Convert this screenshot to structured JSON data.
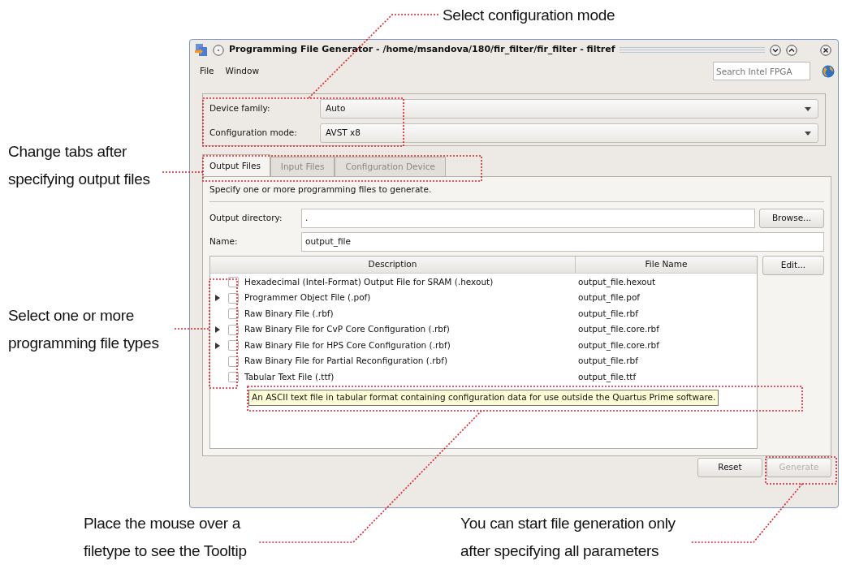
{
  "callouts": [
    {
      "text": "Select configuration mode"
    },
    {
      "text": "Change tabs after specifying output files"
    },
    {
      "text": "Select one or more programming file types"
    },
    {
      "text": "Place the mouse over a filetype to see the Tooltip"
    },
    {
      "text": "You can start file generation only after specifying all parameters"
    }
  ],
  "window": {
    "title": "Programming File Generator - /home/msandova/180/fir_filter/fir_filter - filtref"
  },
  "menu": [
    "File",
    "Window"
  ],
  "search": {
    "placeholder": "Search Intel FPGA"
  },
  "device_settings": [
    {
      "label": "Device family:",
      "value": "Auto"
    },
    {
      "label": "Configuration mode:",
      "value": "AVST x8"
    }
  ],
  "tabs": [
    {
      "label": "Output Files",
      "selected": true,
      "disabled": false
    },
    {
      "label": "Input Files",
      "selected": false,
      "disabled": true
    },
    {
      "label": "Configuration Device",
      "selected": false,
      "disabled": true
    }
  ],
  "instruction": "Specify one or more programming files to generate.",
  "output_directory": {
    "label": "Output directory:",
    "value": ".",
    "button": "Browse..."
  },
  "name": {
    "label": "Name:",
    "value": "output_file"
  },
  "table": {
    "columns": [
      "Description",
      "File Name"
    ],
    "edit_button": "Edit...",
    "rows": [
      {
        "description": "Hexadecimal (Intel-Format) Output File for SRAM (.hexout)",
        "file_name": "output_file.hexout",
        "checked": false,
        "expandable": false
      },
      {
        "description": "Programmer Object File (.pof)",
        "file_name": "output_file.pof",
        "checked": false,
        "expandable": true
      },
      {
        "description": "Raw Binary File (.rbf)",
        "file_name": "output_file.rbf",
        "checked": false,
        "expandable": false
      },
      {
        "description": "Raw Binary File for CvP Core Configuration (.rbf)",
        "file_name": "output_file.core.rbf",
        "checked": false,
        "expandable": true
      },
      {
        "description": "Raw Binary File for HPS Core Configuration (.rbf)",
        "file_name": "output_file.core.rbf",
        "checked": false,
        "expandable": true
      },
      {
        "description": "Raw Binary File for Partial Reconfiguration (.rbf)",
        "file_name": "output_file.rbf",
        "checked": false,
        "expandable": false
      },
      {
        "description": "Tabular Text File (.ttf)",
        "file_name": "output_file.ttf",
        "checked": false,
        "expandable": false
      }
    ]
  },
  "tooltip": "An ASCII text file in tabular format containing configuration data for use outside the Quartus Prime software.",
  "buttons": [
    {
      "label": "Reset",
      "disabled": false
    },
    {
      "label": "Generate",
      "disabled": true
    }
  ]
}
